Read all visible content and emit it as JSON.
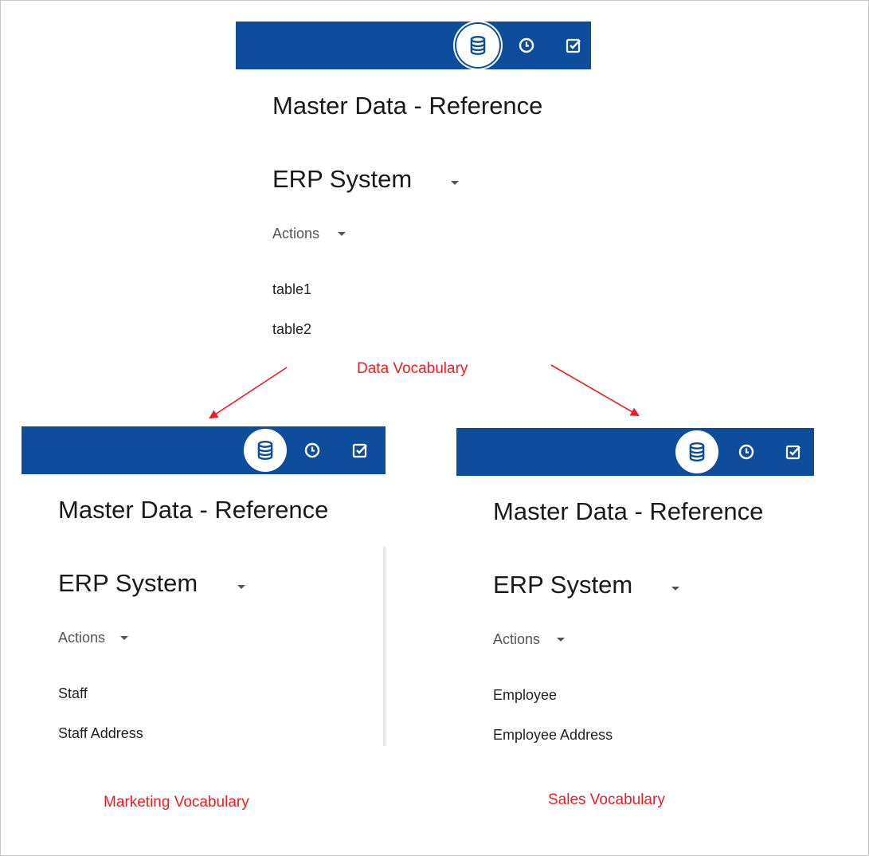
{
  "top_panel": {
    "title": "Master Data - Reference",
    "system": "ERP System",
    "actions_label": "Actions",
    "items": [
      "table1",
      "table2"
    ],
    "vocabulary_label": "Data Vocabulary"
  },
  "left_panel": {
    "title": "Master Data - Reference",
    "system": "ERP System",
    "actions_label": "Actions",
    "items": [
      "Staff",
      "Staff Address"
    ],
    "vocabulary_label": "Marketing Vocabulary"
  },
  "right_panel": {
    "title": "Master Data - Reference",
    "system": "ERP System",
    "actions_label": "Actions",
    "items": [
      "Employee",
      "Employee Address"
    ],
    "vocabulary_label": "Sales Vocabulary"
  },
  "toolbar_icons": [
    "database-icon",
    "clock-icon",
    "checkbox-icon"
  ],
  "colors": {
    "toolbar": "#0d4d9c",
    "annotation": "#ee1c24"
  }
}
